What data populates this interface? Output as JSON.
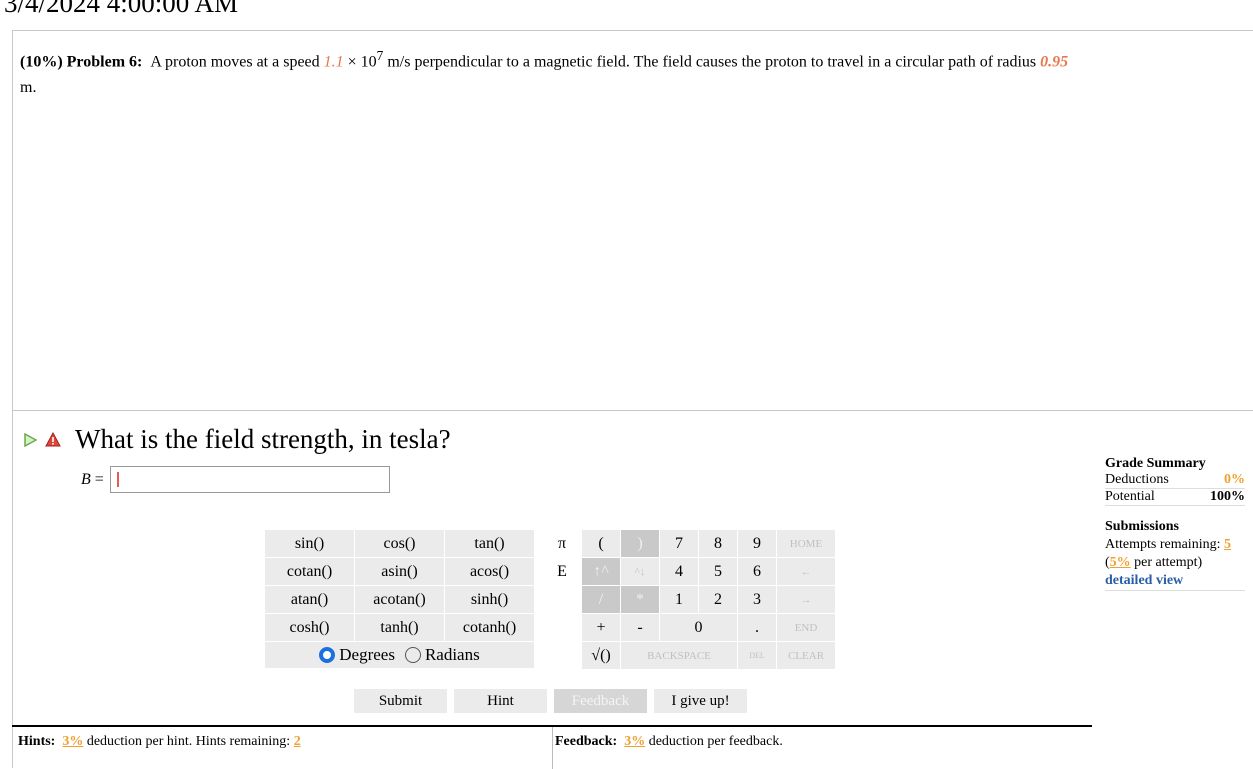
{
  "timestamp": "3/4/2024 4:00:00 AM",
  "problem": {
    "weight": "(10%)",
    "label": "Problem 6:",
    "text1": "A proton moves at a speed ",
    "speed_mantissa": "1.1",
    "times": " × 10",
    "exponent": "7",
    "text2": " m/s perpendicular to a magnetic field. The field causes the proton to travel in a circular path of radius ",
    "radius": "0.95",
    "text3": "m."
  },
  "question": {
    "text": "What is the field strength, in tesla?",
    "var": "B",
    "eq": "=",
    "answer_value": ""
  },
  "grade_summary": {
    "title": "Grade Summary",
    "deductions_label": "Deductions",
    "deductions_value": "0%",
    "potential_label": "Potential",
    "potential_value": "100%"
  },
  "submissions": {
    "title": "Submissions",
    "attempts_label": "Attempts remaining:",
    "attempts_value": "5",
    "open": "(",
    "per_attempt_value": "5%",
    "per_attempt_label": " per attempt)",
    "detailed_view": "detailed view"
  },
  "keypad": {
    "functions": [
      "sin()",
      "cos()",
      "tan()",
      "cotan()",
      "asin()",
      "acos()",
      "atan()",
      "acotan()",
      "sinh()",
      "cosh()",
      "tanh()",
      "cotanh()"
    ],
    "degrees_label": "Degrees",
    "radians_label": "Radians",
    "angle_mode": "Degrees",
    "numpad": [
      [
        "π",
        "(",
        ")",
        "7",
        "8",
        "9",
        "HOME"
      ],
      [
        "E",
        "↑^",
        "^↓",
        "4",
        "5",
        "6",
        "←"
      ],
      [
        "",
        "/",
        "*",
        "1",
        "2",
        "3",
        "→"
      ],
      [
        "",
        "+",
        "-",
        "0",
        "",
        ".",
        "END"
      ],
      [
        "",
        "√()",
        "BACKSPACE",
        "",
        "",
        "DEL",
        "CLEAR"
      ]
    ]
  },
  "actions": {
    "submit": "Submit",
    "hint": "Hint",
    "feedback": "Feedback",
    "give_up": "I give up!"
  },
  "hints_bar": {
    "hints_label": "Hints:",
    "hints_pct": "3%",
    "hints_text": " deduction per hint. Hints remaining: ",
    "hints_remaining": "2",
    "feedback_label": "Feedback:",
    "feedback_pct": "3%",
    "feedback_text": " deduction per feedback."
  }
}
